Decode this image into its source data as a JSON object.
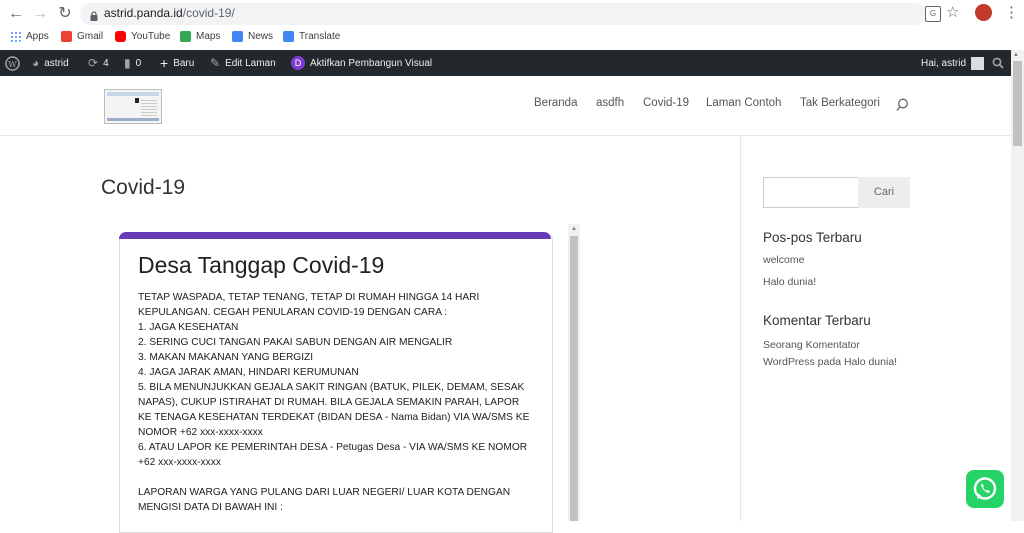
{
  "browser": {
    "url_host": "astrid.panda.id",
    "url_path": "/covid-19/"
  },
  "bookmarks": [
    {
      "label": "Apps",
      "color": "#4285f4"
    },
    {
      "label": "Gmail",
      "color": "#ea4335"
    },
    {
      "label": "YouTube",
      "color": "#ff0000"
    },
    {
      "label": "Maps",
      "color": "#34a853"
    },
    {
      "label": "News",
      "color": "#4285f4"
    },
    {
      "label": "Translate",
      "color": "#4285f4"
    }
  ],
  "adminbar": {
    "site": "astrid",
    "updates": "4",
    "comments": "0",
    "new": "Baru",
    "edit": "Edit Laman",
    "builder": "Aktifkan Pembangun Visual",
    "greeting": "Hai, astrid"
  },
  "nav": [
    "Beranda",
    "asdfh",
    "Covid-19",
    "Laman Contoh",
    "Tak Berkategori"
  ],
  "page": {
    "title": "Covid-19"
  },
  "form": {
    "title": "Desa Tanggap Covid-19",
    "body": "TETAP WASPADA, TETAP TENANG, TETAP DI RUMAH HINGGA 14 HARI\nKEPULANGAN. CEGAH PENULARAN COVID-19 DENGAN CARA :\n1. JAGA KESEHATAN\n2. SERING CUCI TANGAN PAKAI SABUN DENGAN AIR MENGALIR\n3. MAKAN MAKANAN YANG BERGIZI\n4. JAGA JARAK AMAN, HINDARI KERUMUNAN\n5. BILA MENUNJUKKAN GEJALA SAKIT RINGAN (BATUK, PILEK, DEMAM, SESAK\nNAPAS), CUKUP ISTIRAHAT DI RUMAH. BILA GEJALA SEMAKIN PARAH, LAPOR\nKE TENAGA KESEHATAN TERDEKAT (BIDAN DESA - Nama Bidan) VIA WA/SMS KE\nNOMOR +62 xxx-xxxx-xxxx\n6. ATAU LAPOR KE PEMERINTAH DESA - Petugas Desa - VIA WA/SMS KE NOMOR\n+62 xxx-xxxx-xxxx\n\nLAPORAN WARGA YANG PULANG DARI LUAR NEGERI/ LUAR KOTA DENGAN\nMENGISI DATA DI BAWAH INI :"
  },
  "sidebar": {
    "search_button": "Cari",
    "recent_posts_title": "Pos-pos Terbaru",
    "recent_posts": [
      "welcome",
      "Halo dunia!"
    ],
    "recent_comments_title": "Komentar Terbaru",
    "comment_author": "Seorang Komentator WordPress",
    "comment_connector": "pada",
    "comment_post": "Halo dunia!"
  }
}
